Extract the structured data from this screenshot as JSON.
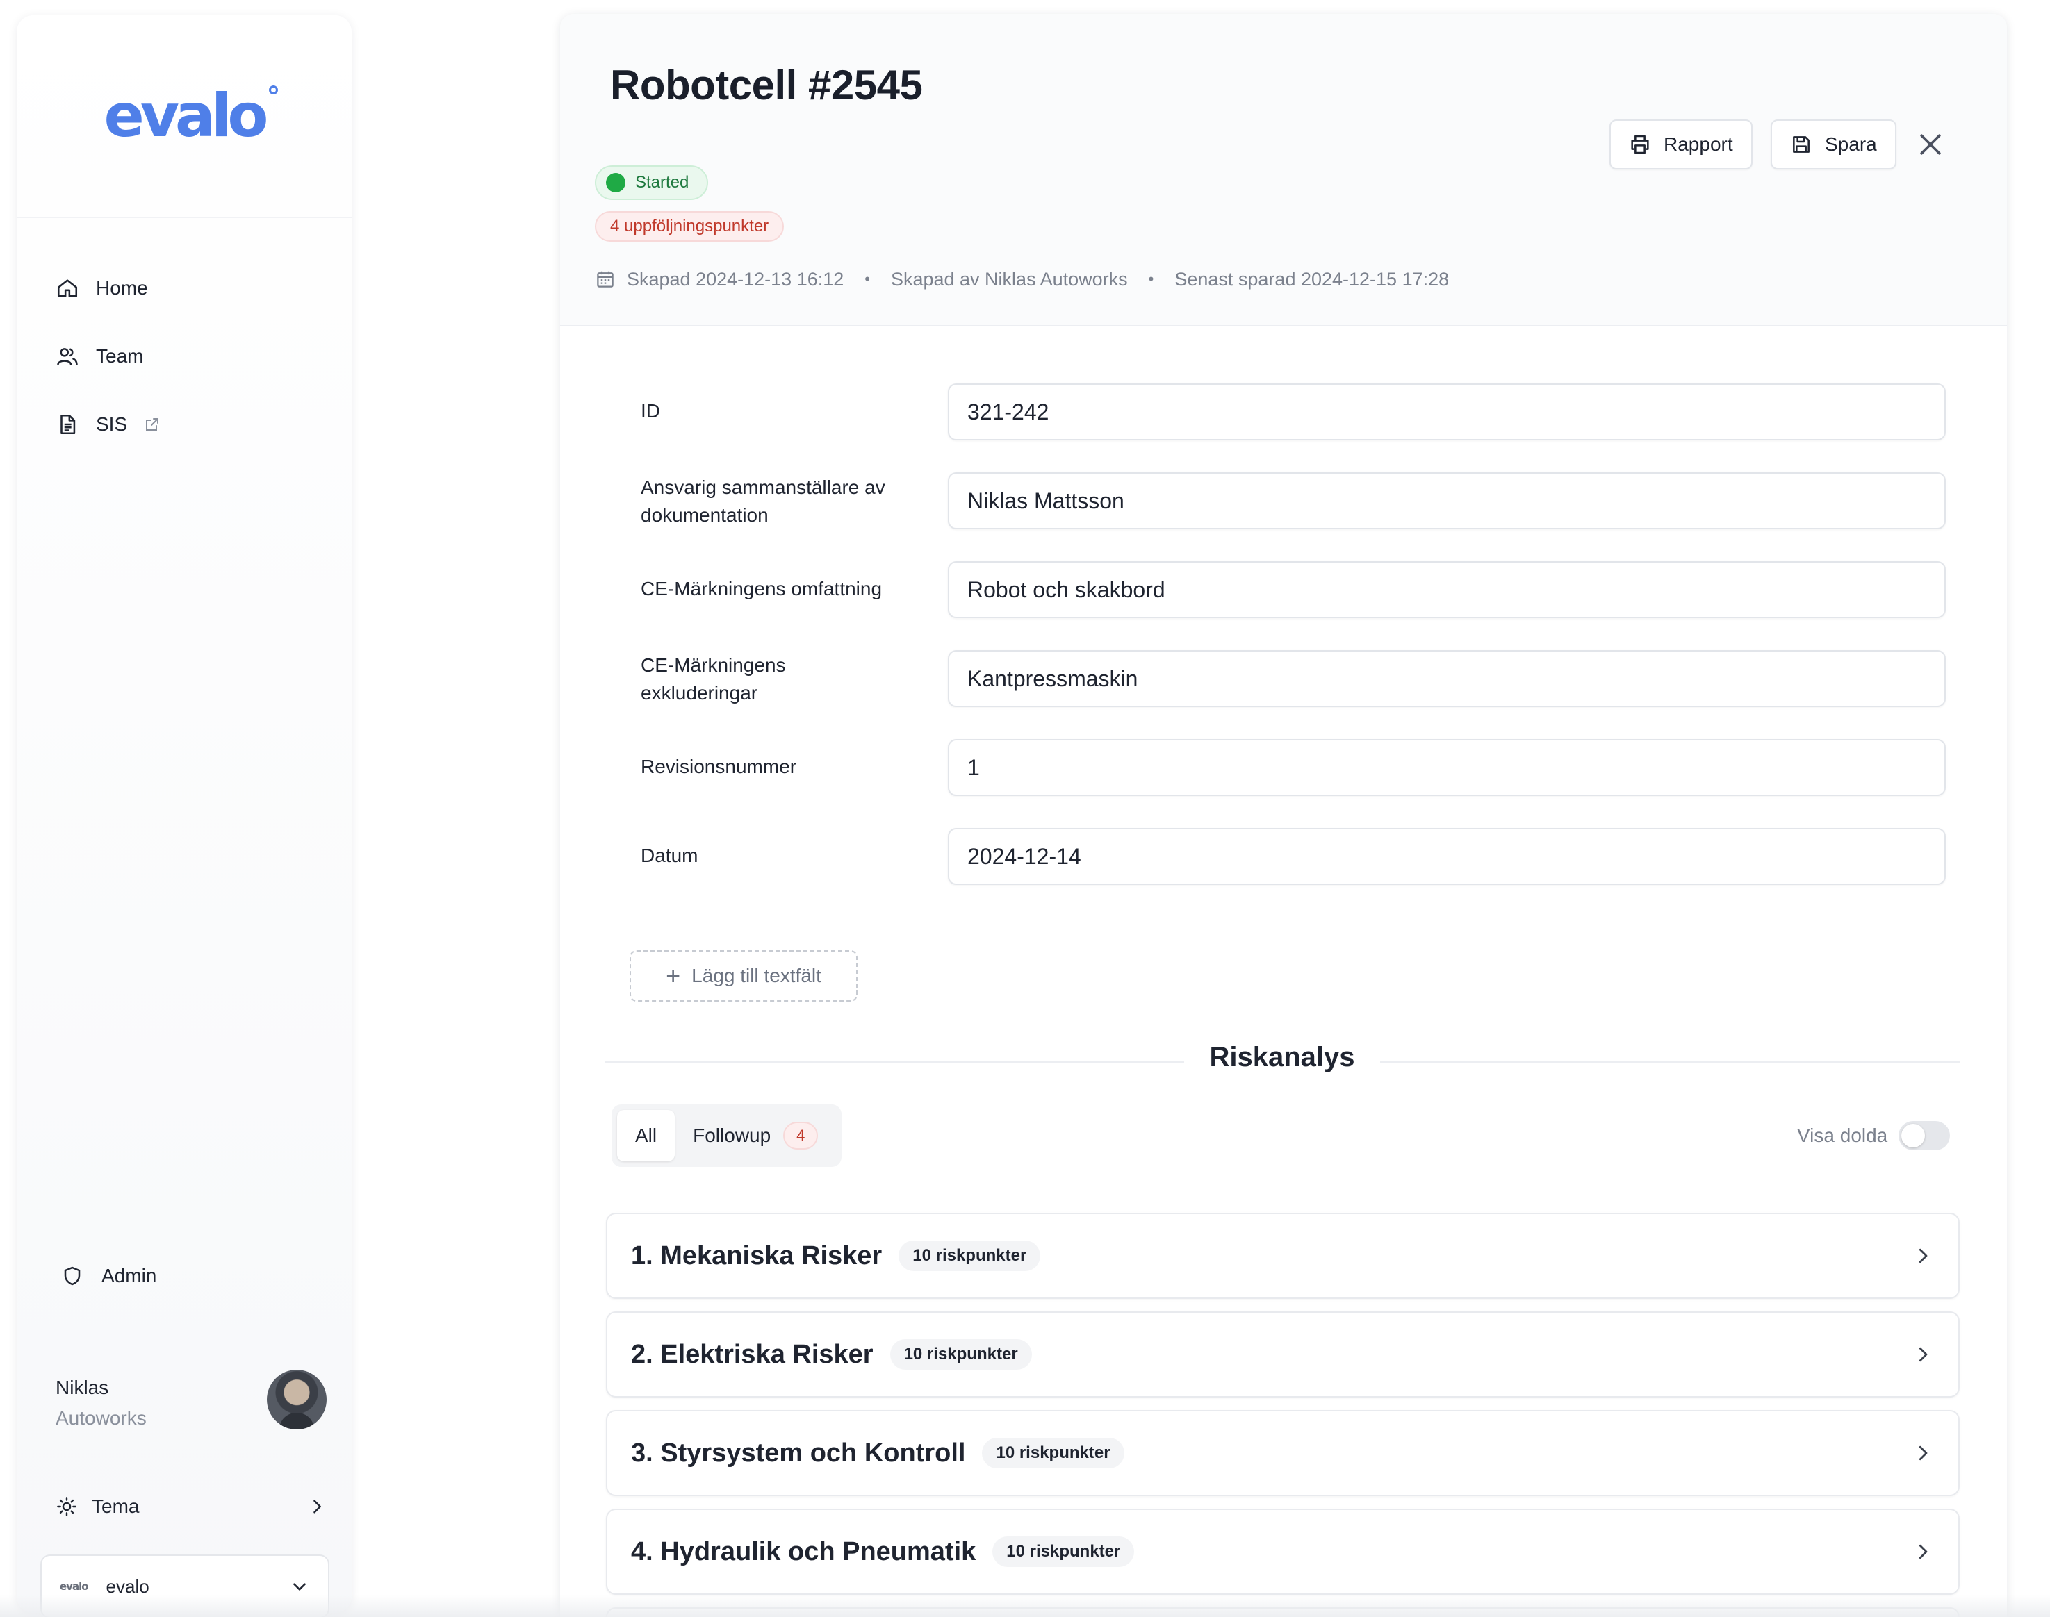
{
  "sidebar": {
    "logo": "evalo",
    "nav": [
      {
        "label": "Home",
        "icon": "home-icon"
      },
      {
        "label": "Team",
        "icon": "users-icon"
      },
      {
        "label": "SIS",
        "icon": "document-icon",
        "external": true
      }
    ],
    "admin": {
      "label": "Admin",
      "icon": "shield-icon"
    },
    "user": {
      "name": "Niklas",
      "org": "Autoworks"
    },
    "theme": {
      "label": "Tema"
    },
    "org_select": {
      "logo": "evalo",
      "value": "evalo"
    }
  },
  "document": {
    "title": "Robotcell #2545",
    "status": "Started",
    "followup_badge": "4 uppföljningspunkter",
    "meta": {
      "created": "Skapad 2024-12-13 16:12",
      "created_by": "Skapad av Niklas Autoworks",
      "last_saved": "Senast sparad 2024-12-15 17:28"
    },
    "actions": {
      "report": "Rapport",
      "save": "Spara"
    }
  },
  "form": {
    "fields": [
      {
        "label": "ID",
        "value": "321-242"
      },
      {
        "label": "Ansvarig sammanställare av dokumentation",
        "value": "Niklas Mattsson"
      },
      {
        "label": "CE-Märkningens omfattning",
        "value": "Robot och skakbord"
      },
      {
        "label": "CE-Märkningens exkluderingar",
        "value": "Kantpressmaskin"
      },
      {
        "label": "Revisionsnummer",
        "value": "1"
      },
      {
        "label": "Datum",
        "value": "2024-12-14"
      }
    ],
    "add_field": "Lägg till textfält"
  },
  "risk": {
    "title": "Riskanalys",
    "tabs": [
      {
        "label": "All",
        "active": true
      },
      {
        "label": "Followup",
        "count": "4"
      }
    ],
    "show_hidden": {
      "label": "Visa dolda",
      "on": false
    },
    "categories": [
      {
        "title": "1. Mekaniska Risker",
        "count": "10 riskpunkter"
      },
      {
        "title": "2. Elektriska Risker",
        "count": "10 riskpunkter"
      },
      {
        "title": "3. Styrsystem och Kontroll",
        "count": "10 riskpunkter"
      },
      {
        "title": "4. Hydraulik och Pneumatik",
        "count": "10 riskpunkter"
      }
    ]
  },
  "colors": {
    "brand": "#4f7fe8",
    "status_green": "#1faa45",
    "followup_red": "#c0392b"
  }
}
